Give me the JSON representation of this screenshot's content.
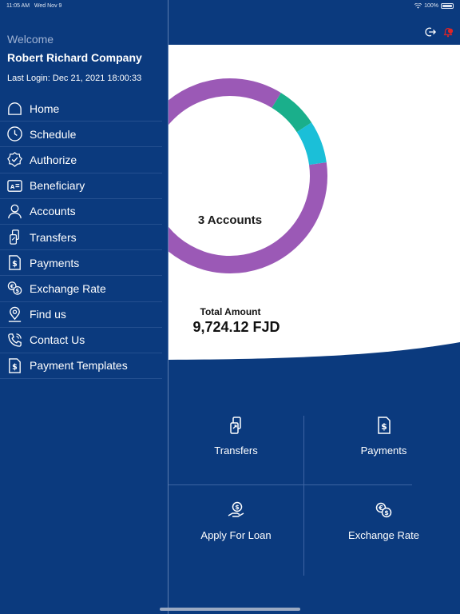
{
  "status_bar": {
    "time": "11:05 AM",
    "date": "Wed Nov 9",
    "battery": "100%"
  },
  "drawer": {
    "welcome": "Welcome",
    "company": "Robert Richard Company",
    "last_login": "Last Login: Dec 21, 2021 18:00:33",
    "items": [
      {
        "label": "Home",
        "icon": "home-icon"
      },
      {
        "label": "Schedule",
        "icon": "schedule-icon"
      },
      {
        "label": "Authorize",
        "icon": "authorize-badge-icon"
      },
      {
        "label": "Beneficiary",
        "icon": "beneficiary-card-icon"
      },
      {
        "label": "Accounts",
        "icon": "user-icon"
      },
      {
        "label": "Transfers",
        "icon": "transfer-icon"
      },
      {
        "label": "Payments",
        "icon": "payment-dollar-icon"
      },
      {
        "label": "Exchange Rate",
        "icon": "exchange-rate-icon"
      },
      {
        "label": "Find us",
        "icon": "map-pin-icon"
      },
      {
        "label": "Contact Us",
        "icon": "phone-icon"
      },
      {
        "label": "Payment Templates",
        "icon": "payment-template-icon"
      }
    ]
  },
  "summary": {
    "donut_center": "3 Accounts",
    "total_label": "Total Amount",
    "total_value": "9,724.12 FJD"
  },
  "chart_data": {
    "type": "pie",
    "values": [
      86,
      7,
      7
    ],
    "colors": [
      "#9b59b6",
      "#1aaf8b",
      "#1bbfd8"
    ]
  },
  "tiles": {
    "transfers": "Transfers",
    "payments": "Payments",
    "loan": "Apply For Loan",
    "exchange": "Exchange Rate"
  },
  "colors": {
    "primary": "#0b3a7e",
    "purple": "#9b59b6",
    "teal": "#1aaf8b",
    "cyan": "#1bbfd8",
    "bell": "#e02424"
  }
}
